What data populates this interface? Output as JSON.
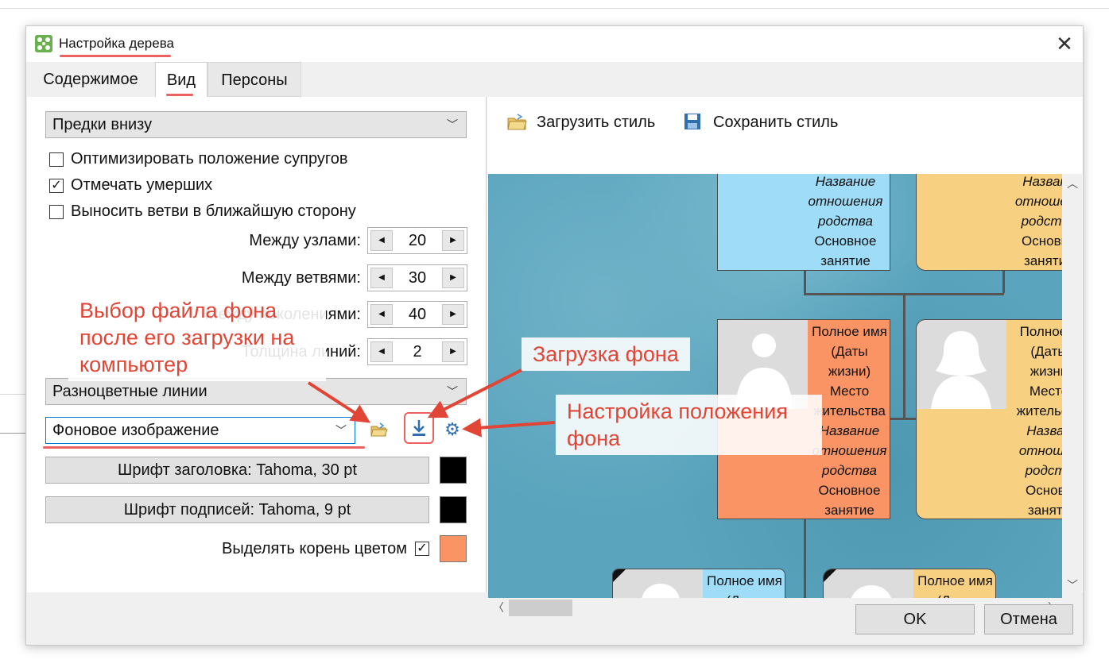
{
  "dialog": {
    "title": "Настройка дерева",
    "close": "✕"
  },
  "tabs": [
    "Содержимое",
    "Вид",
    "Персоны"
  ],
  "left": {
    "layout_combo": "Предки внизу",
    "checkboxes": [
      {
        "label": "Оптимизировать положение супругов",
        "checked": false
      },
      {
        "label": "Отмечать умерших",
        "checked": true
      },
      {
        "label": "Выносить ветви в ближайшую сторону",
        "checked": false
      }
    ],
    "spinners": [
      {
        "label": "Между узлами:",
        "value": "20"
      },
      {
        "label": "Между ветвями:",
        "value": "30"
      },
      {
        "label": "Между поколениями:",
        "value": "40"
      },
      {
        "label": "Толщина линий:",
        "value": "2"
      }
    ],
    "lines_combo": "Разноцветные линии",
    "background_combo": "Фоновое изображение",
    "title_font_btn": "Шрифт заголовка: Tahoma, 30 pt",
    "title_font_color": "#000000",
    "caption_font_btn": "Шрифт подписей: Tahoma, 9 pt",
    "caption_font_color": "#000000",
    "root_highlight_label": "Выделять корень цветом",
    "root_highlight_checked": true,
    "root_color": "#fa9464"
  },
  "toolbar": {
    "load_style": "Загрузить стиль",
    "save_style": "Сохранить стиль"
  },
  "preview": {
    "card_top_left": [
      "Название",
      "отношения",
      "родства",
      "Основное",
      "занятие"
    ],
    "card_top_right": [
      "Назван",
      "отношен",
      "родств",
      "Основн",
      "заняти"
    ],
    "card_mid_left": [
      "Полное имя",
      "(Даты",
      "жизни)",
      "Место",
      "жительства",
      "Название",
      "отношения",
      "родства",
      "Основное",
      "занятие"
    ],
    "card_mid_right": [
      "Полное и",
      "(Даты",
      "жизни",
      "Место",
      "жительств",
      "Назван",
      "отношен",
      "родств",
      "Основн",
      "заняти"
    ],
    "card_bot_left": [
      "Полное имя",
      "(Даты"
    ],
    "card_bot_right": [
      "Полное имя",
      "(Даты"
    ]
  },
  "footer": {
    "ok": "OK",
    "cancel": "Отмена"
  },
  "annotations": {
    "file_choice": "Выбор файла фона после его загрузки на компьютер",
    "load_bg": "Загрузка фона",
    "bg_position": "Настройка положения фона"
  },
  "colors": {
    "accent": "#e04535",
    "blue_card": "#9fdcf7",
    "yellow_card": "#f8d081",
    "orange_card": "#fa9464"
  }
}
